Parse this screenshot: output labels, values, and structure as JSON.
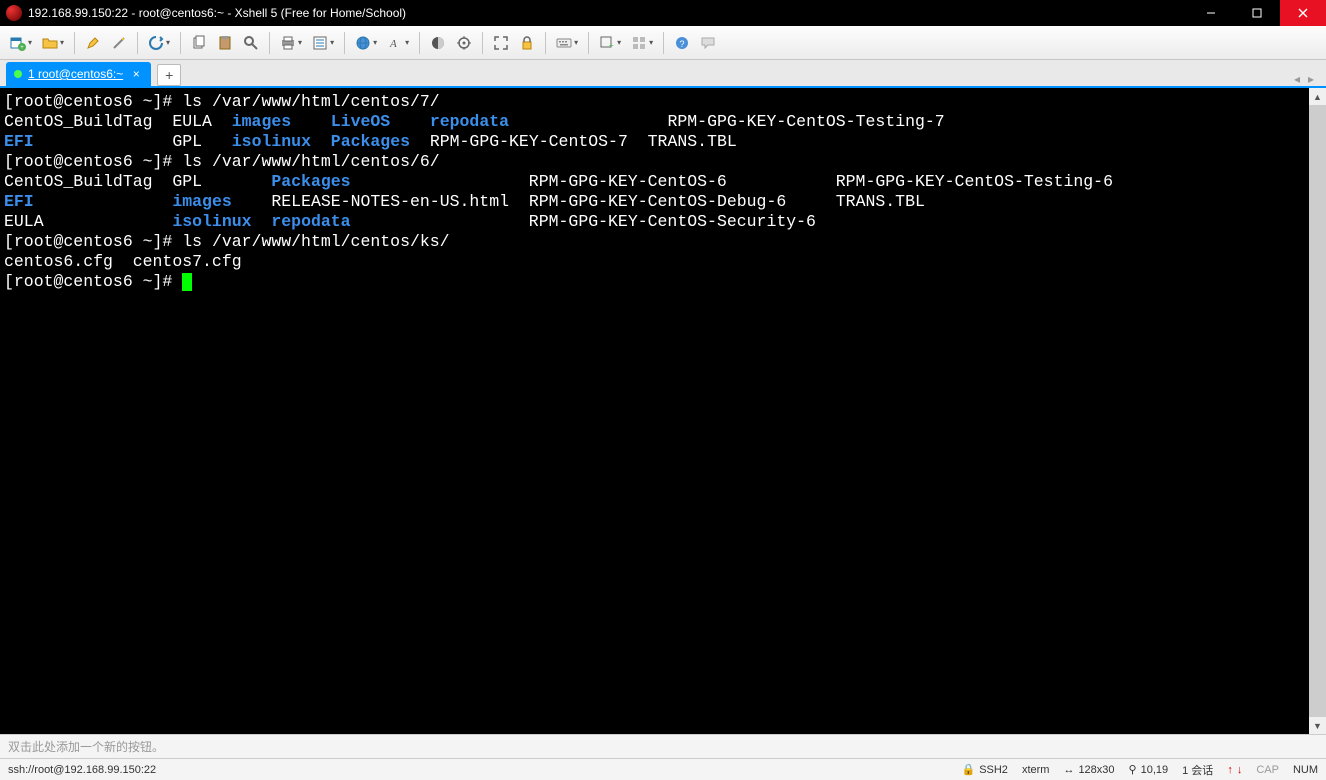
{
  "window": {
    "title": "192.168.99.150:22 - root@centos6:~ - Xshell 5 (Free for Home/School)"
  },
  "tab": {
    "label": "1 root@centos6:~",
    "close": "×"
  },
  "newtab": "+",
  "terminal": {
    "l1_prompt": "[root@centos6 ~]# ",
    "l1_cmd": "ls /var/www/html/centos/7/",
    "l2_a": "CentOS_BuildTag  EULA  ",
    "l2_b": "images",
    "l2_c": "    ",
    "l2_d": "LiveOS",
    "l2_e": "    ",
    "l2_f": "repodata",
    "l2_g": "                RPM-GPG-KEY-CentOS-Testing-7",
    "l3_a": "EFI",
    "l3_b": "              GPL   ",
    "l3_c": "isolinux",
    "l3_d": "  ",
    "l3_e": "Packages",
    "l3_f": "  RPM-GPG-KEY-CentOS-7  TRANS.TBL",
    "l4_prompt": "[root@centos6 ~]# ",
    "l4_cmd": "ls /var/www/html/centos/6/",
    "l5_a": "CentOS_BuildTag  GPL       ",
    "l5_b": "Packages",
    "l5_c": "                  RPM-GPG-KEY-CentOS-6           RPM-GPG-KEY-CentOS-Testing-6",
    "l6_a": "EFI",
    "l6_b": "              ",
    "l6_c": "images",
    "l6_d": "    RELEASE-NOTES-en-US.html  RPM-GPG-KEY-CentOS-Debug-6     TRANS.TBL",
    "l7_a": "EULA             ",
    "l7_b": "isolinux",
    "l7_c": "  ",
    "l7_d": "repodata",
    "l7_e": "                  RPM-GPG-KEY-CentOS-Security-6",
    "l8_prompt": "[root@centos6 ~]# ",
    "l8_cmd": "ls /var/www/html/centos/ks/",
    "l9": "centos6.cfg  centos7.cfg",
    "l10_prompt": "[root@centos6 ~]# "
  },
  "quickbar": "双击此处添加一个新的按钮。",
  "statusbar": {
    "uri": "ssh://root@192.168.99.150:22",
    "ssh": "SSH2",
    "term": "xterm",
    "size": "128x30",
    "pos": "10,19",
    "sessions": "1 会话",
    "arrows_up": "↑",
    "arrows_dn": "↓",
    "cap": "CAP",
    "num": "NUM",
    "lock_icon": "🔒",
    "size_icon": "↔",
    "pos_icon": "⚲"
  }
}
